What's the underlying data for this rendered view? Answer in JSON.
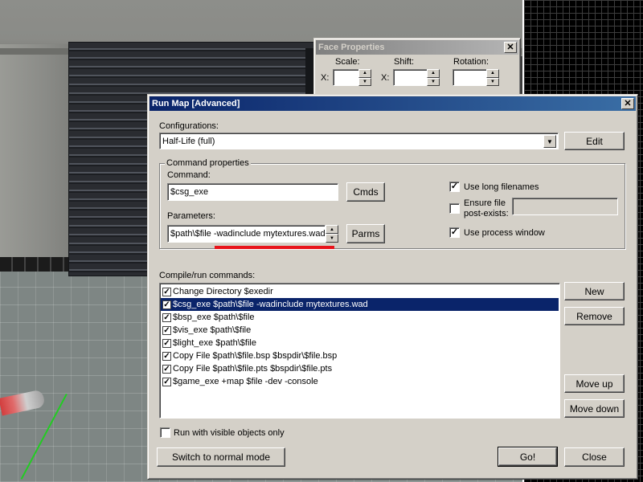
{
  "face_properties": {
    "title": "Face Properties",
    "scale_label": "Scale:",
    "shift_label": "Shift:",
    "rotation_label": "Rotation:",
    "x_label": "X:"
  },
  "run_map": {
    "title": "Run Map [Advanced]",
    "configurations_label": "Configurations:",
    "configuration_value": "Half-Life (full)",
    "edit_button": "Edit",
    "command_properties_label": "Command properties",
    "command_label": "Command:",
    "command_value": "$csg_exe",
    "cmds_button": "Cmds",
    "parameters_label": "Parameters:",
    "parameters_value": "$path\\$file -wadinclude mytextures.wad",
    "parms_button": "Parms",
    "use_long_filenames": {
      "label": "Use long filenames",
      "checked": true
    },
    "ensure_file_line1": "Ensure file",
    "ensure_file_line2": "post-exists:",
    "ensure_file_checked": false,
    "use_process_window": {
      "label": "Use process window",
      "checked": true
    },
    "compile_label": "Compile/run commands:",
    "commands": [
      {
        "text": "Change Directory $exedir",
        "checked": true,
        "selected": false
      },
      {
        "text": "$csg_exe $path\\$file -wadinclude mytextures.wad",
        "checked": true,
        "selected": true
      },
      {
        "text": "$bsp_exe $path\\$file",
        "checked": true,
        "selected": false
      },
      {
        "text": "$vis_exe $path\\$file",
        "checked": true,
        "selected": false
      },
      {
        "text": "$light_exe $path\\$file",
        "checked": true,
        "selected": false
      },
      {
        "text": "Copy File $path\\$file.bsp $bspdir\\$file.bsp",
        "checked": true,
        "selected": false
      },
      {
        "text": "Copy File $path\\$file.pts $bspdir\\$file.pts",
        "checked": true,
        "selected": false
      },
      {
        "text": "$game_exe +map $file -dev -console",
        "checked": true,
        "selected": false
      }
    ],
    "new_button": "New",
    "remove_button": "Remove",
    "move_up_button": "Move up",
    "move_down_button": "Move down",
    "run_visible_label": "Run with visible objects only",
    "run_visible_checked": false,
    "switch_mode_button": "Switch to normal mode",
    "go_button": "Go!",
    "close_button": "Close",
    "check_glyph": "✓",
    "close_glyph": "✕"
  },
  "colors": {
    "titlebar_active": "#0a246a",
    "highlight_annotation": "#e8141b"
  }
}
